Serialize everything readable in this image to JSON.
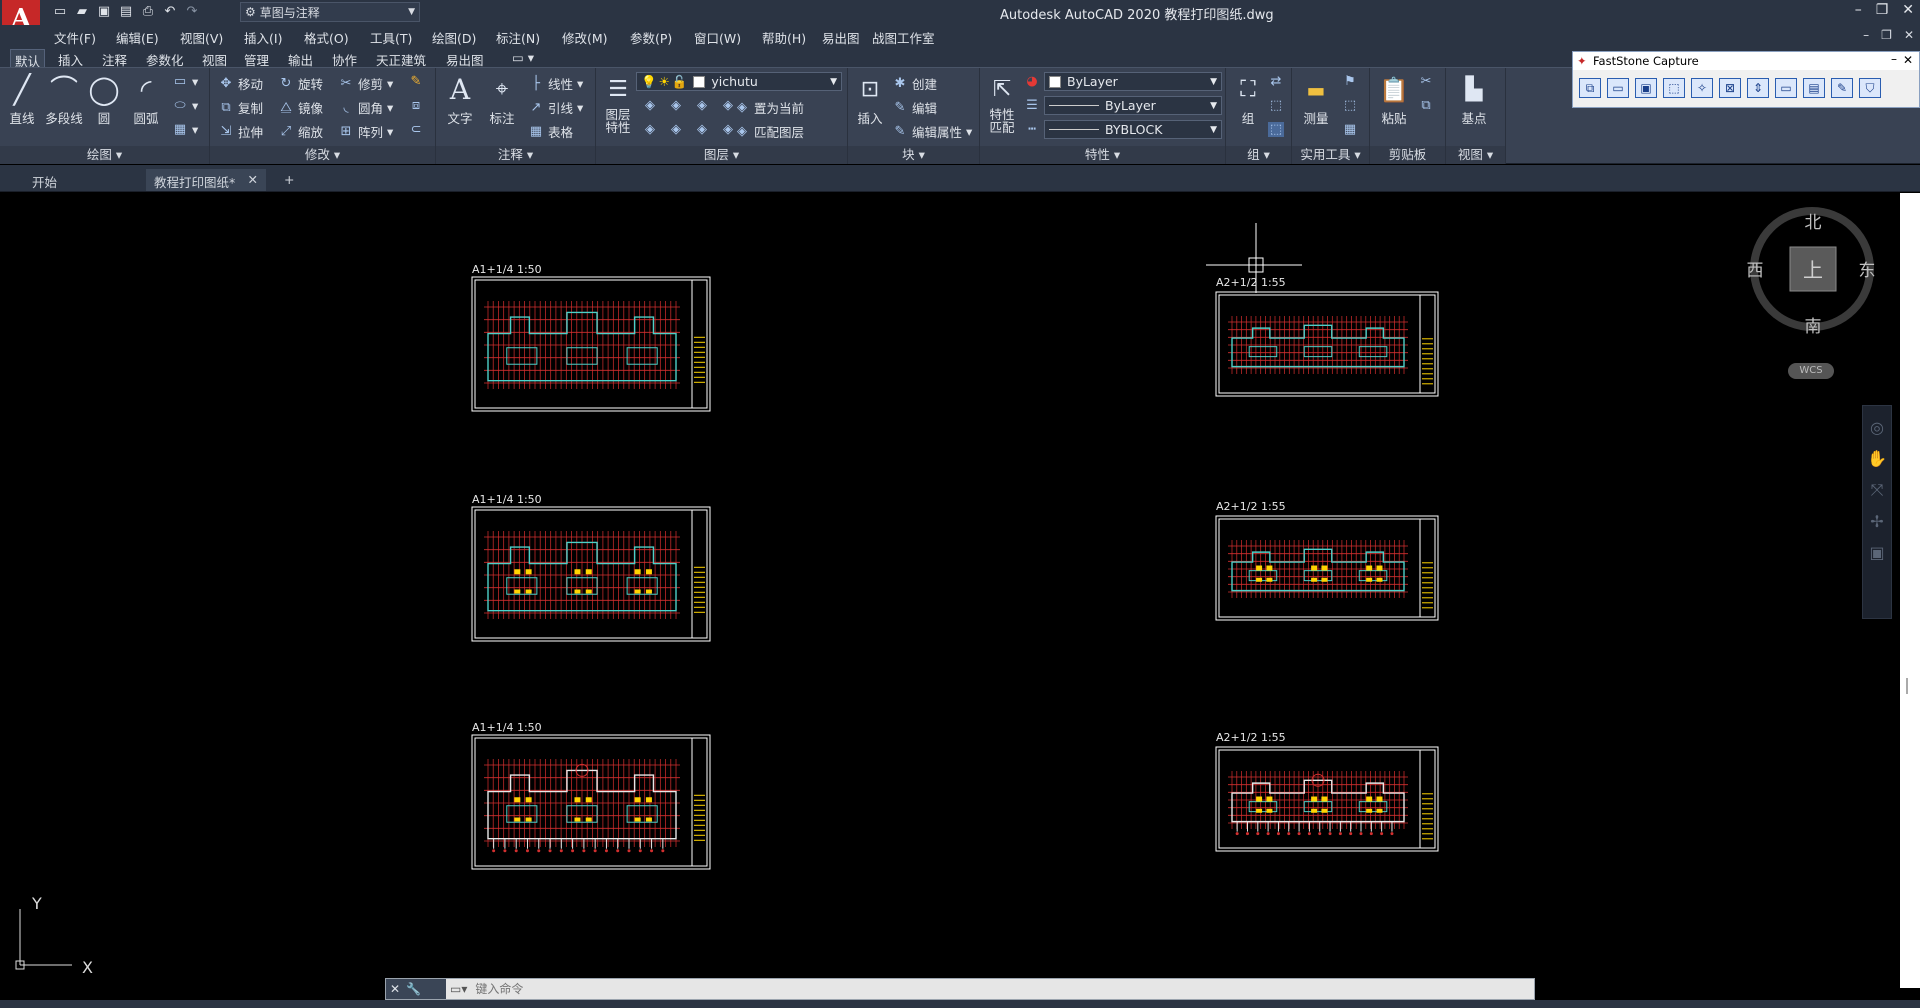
{
  "app": {
    "title": "Autodesk AutoCAD 2020    教程打印图纸.dwg",
    "logo": "A",
    "workspace": "草图与注释"
  },
  "menu": [
    "文件(F)",
    "编辑(E)",
    "视图(V)",
    "插入(I)",
    "格式(O)",
    "工具(T)",
    "绘图(D)",
    "标注(N)",
    "修改(M)",
    "参数(P)",
    "窗口(W)",
    "帮助(H)",
    "易出图",
    "战图工作室"
  ],
  "ribbon_tabs": [
    "默认",
    "插入",
    "注释",
    "参数化",
    "视图",
    "管理",
    "输出",
    "协作",
    "天正建筑",
    "易出图"
  ],
  "panels": {
    "draw": {
      "title": "绘图 ▾",
      "tools": [
        "直线",
        "多段线",
        "圆",
        "圆弧"
      ]
    },
    "modify": {
      "title": "修改 ▾",
      "rows": [
        "移动",
        "旋转",
        "修剪",
        "复制",
        "镜像",
        "圆角",
        "拉伸",
        "缩放",
        "阵列"
      ]
    },
    "annotate": {
      "title": "注释 ▾",
      "tools": [
        "文字",
        "标注"
      ],
      "rows": [
        "线性",
        "引线",
        "表格"
      ]
    },
    "layers": {
      "title": "图层 ▾",
      "tool": "图层\n特性",
      "layer_name": "yichutu",
      "rows": [
        "置为当前",
        "匹配图层"
      ]
    },
    "block": {
      "title": "块 ▾",
      "tool": "插入",
      "rows": [
        "创建",
        "编辑",
        "编辑属性"
      ]
    },
    "properties": {
      "title": "特性 ▾",
      "tool": "特性\n匹配",
      "color": "ByLayer",
      "linetype": "ByLayer",
      "lineweight": "BYBLOCK"
    },
    "groups": {
      "title": "组 ▾",
      "tool": "组"
    },
    "utilities": {
      "title": "实用工具 ▾",
      "tool": "测量"
    },
    "clipboard": {
      "title": "剪贴板",
      "tool": "粘贴"
    },
    "view": {
      "title": "视图 ▾",
      "tool": "基点"
    }
  },
  "doc_tabs": [
    "开始",
    "教程打印图纸*"
  ],
  "faststone": {
    "title": "FastStone Capture"
  },
  "viewcube": {
    "north": "北",
    "south": "南",
    "east": "东",
    "west": "西",
    "top": "上",
    "wcs": "WCS"
  },
  "ucs": {
    "y": "Y",
    "x": "X"
  },
  "sheets": [
    {
      "label": "A1+1/4 1:50",
      "variant": 1
    },
    {
      "label": "A1+1/4 1:50",
      "variant": 2
    },
    {
      "label": "A1+1/4 1:50",
      "variant": 3
    },
    {
      "label": "A2+1/2 1:55",
      "variant": 1
    },
    {
      "label": "A2+1/2 1:55",
      "variant": 2
    },
    {
      "label": "A2+1/2 1:55",
      "variant": 3
    }
  ],
  "command": {
    "placeholder": "键入命令"
  },
  "colors": {
    "ribbon": "#394253",
    "title": "#2b3443",
    "canvas": "#000000",
    "plan_red": "#d32f2f",
    "plan_cyan": "#4dd0c8",
    "plan_yellow": "#ffd400"
  }
}
